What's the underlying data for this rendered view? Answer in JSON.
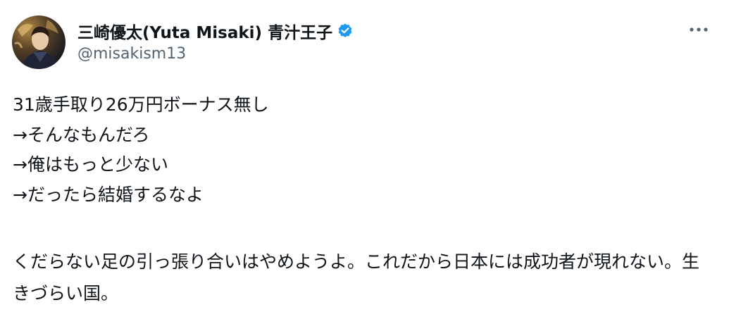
{
  "tweet": {
    "author": {
      "display_name": "三崎優太(Yuta Misaki) 青汁王子",
      "handle": "@misakism13",
      "verified": true,
      "avatar_icon": "profile-photo"
    },
    "more_icon": "more-dots-icon",
    "verified_icon": "verified-badge-icon",
    "text_lines": [
      "31歳手取り26万円ボーナス無し",
      "→そんなもんだろ",
      "→俺はもっと少ない",
      "→だったら結婚するなよ"
    ],
    "text_paragraph_2": "くだらない足の引っ張り合いはやめようよ。これだから日本には成功者が現れない。生きづらい国。"
  },
  "colors": {
    "text": "#0f1419",
    "secondary": "#536471",
    "verified": "#1d9bf0"
  }
}
